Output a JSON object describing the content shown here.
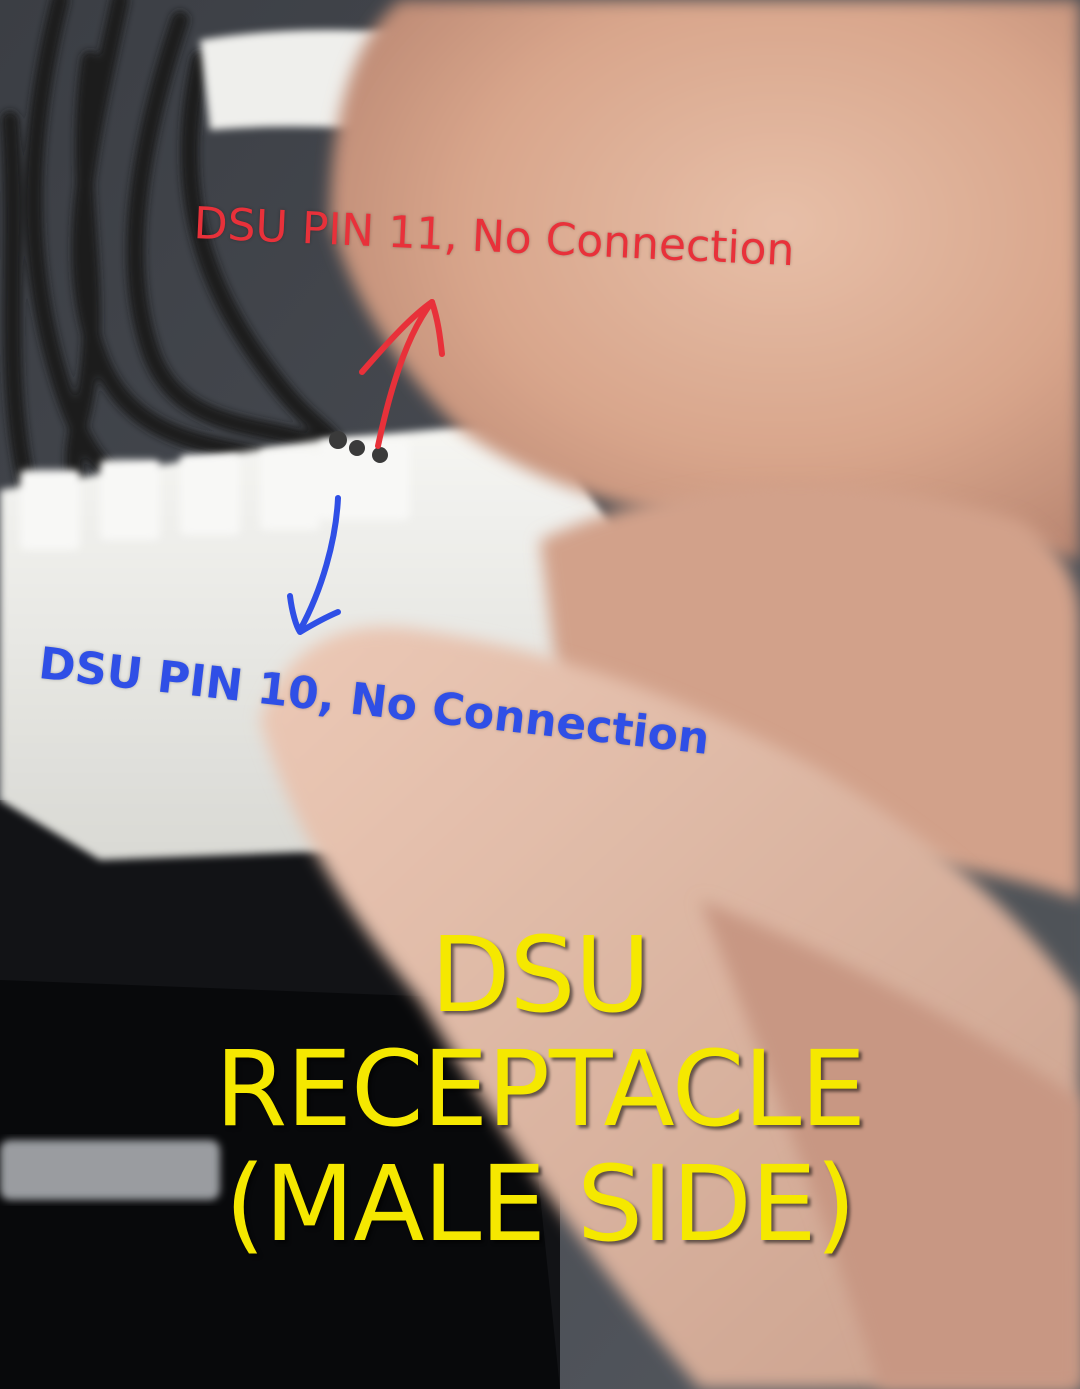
{
  "annotations": {
    "pin11_label": "DSU PIN 11, No Connection",
    "pin10_label": "DSU PIN 10, No Connection"
  },
  "caption": {
    "line1": "DSU",
    "line2": "RECEPTACLE",
    "line3": "(MALE SIDE)"
  },
  "colors": {
    "pin11_annotation": "#e8313a",
    "pin10_annotation": "#2f4fe6",
    "caption_text": "#f5e800"
  }
}
